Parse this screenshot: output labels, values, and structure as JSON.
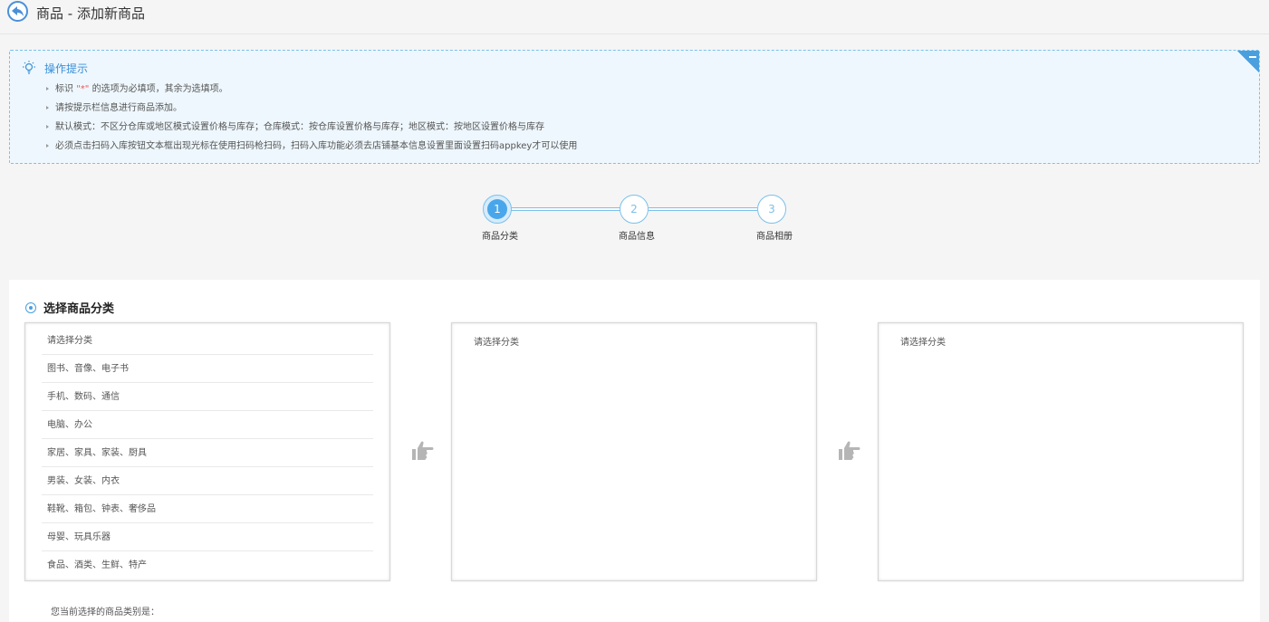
{
  "header": {
    "title": "商品 - 添加新商品"
  },
  "tips": {
    "title": "操作提示",
    "items": [
      {
        "pre": "标识 ",
        "star": "\"*\"",
        "post": " 的选项为必填项，其余为选填项。"
      },
      {
        "text": "请按提示栏信息进行商品添加。"
      },
      {
        "text": "默认模式：不区分仓库或地区模式设置价格与库存；仓库模式：按仓库设置价格与库存；地区模式：按地区设置价格与库存"
      },
      {
        "text": "必须点击扫码入库按钮文本框出现光标在使用扫码枪扫码，扫码入库功能必须去店铺基本信息设置里面设置扫码appkey才可以使用"
      }
    ]
  },
  "steps": [
    {
      "num": "1",
      "label": "商品分类",
      "active": true
    },
    {
      "num": "2",
      "label": "商品信息",
      "active": false
    },
    {
      "num": "3",
      "label": "商品相册",
      "active": false
    }
  ],
  "section": {
    "title": "选择商品分类",
    "col1": [
      "请选择分类",
      "图书、音像、电子书",
      "手机、数码、通信",
      "电脑、办公",
      "家居、家具、家装、厨具",
      "男装、女装、内衣",
      "鞋靴、箱包、钟表、奢侈品",
      "母婴、玩具乐器",
      "食品、酒类、生鲜、特产"
    ],
    "col2_placeholder": "请选择分类",
    "col3_placeholder": "请选择分类",
    "current_label": "您当前选择的商品类别是："
  },
  "colors": {
    "accent": "#4a9fdf",
    "tips_bg": "#eef7fd"
  },
  "icons": [
    "back-arrow-icon",
    "lightbulb-icon",
    "collapse-icon",
    "pointing-hand-icon"
  ]
}
